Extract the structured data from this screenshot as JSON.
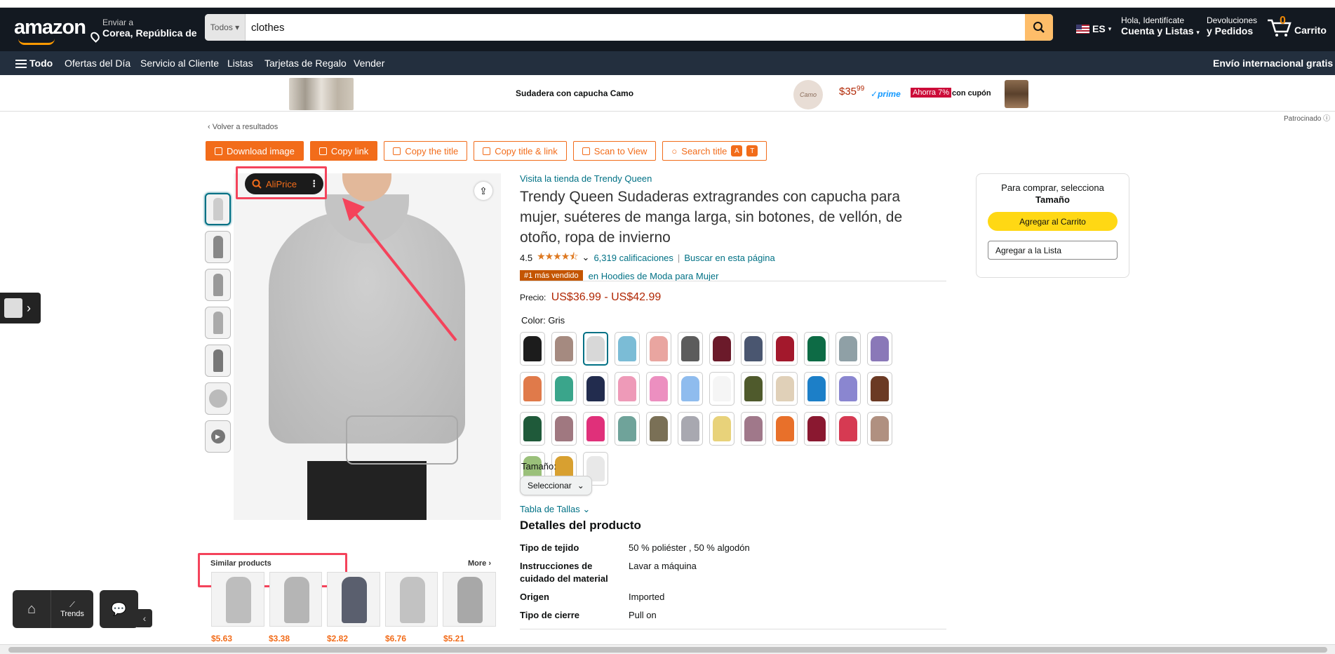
{
  "header": {
    "logo": "amazon",
    "deliver_line1": "Enviar a",
    "deliver_line2": "Corea, República de",
    "search_category": "Todos",
    "search_value": "clothes",
    "language": "ES",
    "account_line1": "Hola, Identifícate",
    "account_line2": "Cuenta y Listas",
    "returns_line1": "Devoluciones",
    "returns_line2": "y Pedidos",
    "cart_count": "0",
    "cart_label": "Carrito"
  },
  "subnav": {
    "all": "Todo",
    "items": [
      "Ofertas del Día",
      "Servicio al Cliente",
      "Listas",
      "Tarjetas de Regalo",
      "Vender"
    ],
    "promo": "Envío internacional gratis"
  },
  "banner": {
    "title": "Sudadera con capucha Camo",
    "price_whole": "$35",
    "price_frac": "99",
    "prime": "prime",
    "save_badge": "Ahorra 7%",
    "coupon": "con cupón",
    "sponsored": "Patrocinado"
  },
  "breadcrumb": "‹ Volver a resultados",
  "toolbar": {
    "download": "Download image",
    "copy_link": "Copy link",
    "copy_title": "Copy the title",
    "copy_title_link": "Copy title & link",
    "scan": "Scan to View",
    "search_title": "Search title"
  },
  "aliprice": "AliPrice",
  "similar": {
    "title": "Similar products",
    "more": "More",
    "prices": [
      "$5.63",
      "$3.38",
      "$2.82",
      "$6.76",
      "$5.21"
    ]
  },
  "product": {
    "store": "Visita la tienda de Trendy Queen",
    "title": "Trendy Queen Sudaderas extragrandes con capucha para mujer, suéteres de manga larga, sin botones, de vellón, de otoño, ropa de invierno",
    "rating": "4.5",
    "stars": "★★★★⯪",
    "ratings_count": "6,319 calificaciones",
    "search_page": "Buscar en esta página",
    "bestseller_badge": "#1 más vendido",
    "bestseller_category": "en Hoodies de Moda para Mujer",
    "price_label": "Precio:",
    "price_range": "US$36.99 - US$42.99",
    "color_label": "Color:",
    "color_value": "Gris",
    "size_label": "Tamaño:",
    "size_select": "Seleccionar",
    "size_chart": "Tabla de Tallas",
    "details_title": "Detalles del producto",
    "details": [
      {
        "k": "Tipo de tejido",
        "v": "50 % poliéster , 50 % algodón"
      },
      {
        "k": "Instrucciones de cuidado del material",
        "v": "Lavar a máquina"
      },
      {
        "k": "Origen",
        "v": "Imported"
      },
      {
        "k": "Tipo de cierre",
        "v": "Pull on"
      }
    ]
  },
  "swatch_colors": [
    "#1c1c1c",
    "#a58a80",
    "#d8d8d8",
    "#7bbcd6",
    "#e9a5a0",
    "#5c5c5c",
    "#6b1a2a",
    "#4a5670",
    "#a3182c",
    "#0d6b45",
    "#8fa0a6",
    "#8a78b8",
    "#e07a4a",
    "#3aa58b",
    "#222c4e",
    "#ee9ab8",
    "#ec8fc0",
    "#8fbcee",
    "#f5f5f5",
    "#4f5a2c",
    "#e0d0b8",
    "#1c7fc8",
    "#8a86d0",
    "#6b3a24",
    "#1f5a3a",
    "#a07880",
    "#e0307a",
    "#6fa39a",
    "#7a7056",
    "#a8a8b0",
    "#e8d27a",
    "#a0788a",
    "#e8702a",
    "#8a1830",
    "#d63a52",
    "#b09080",
    "#9ac07a",
    "#d8a030",
    "#e8e8e8"
  ],
  "buybox": {
    "line1": "Para comprar, selecciona",
    "line2": "Tamaño",
    "add_cart": "Agregar al Carrito",
    "add_list": "Agregar a la Lista"
  },
  "dock": {
    "trends": "Trends"
  }
}
